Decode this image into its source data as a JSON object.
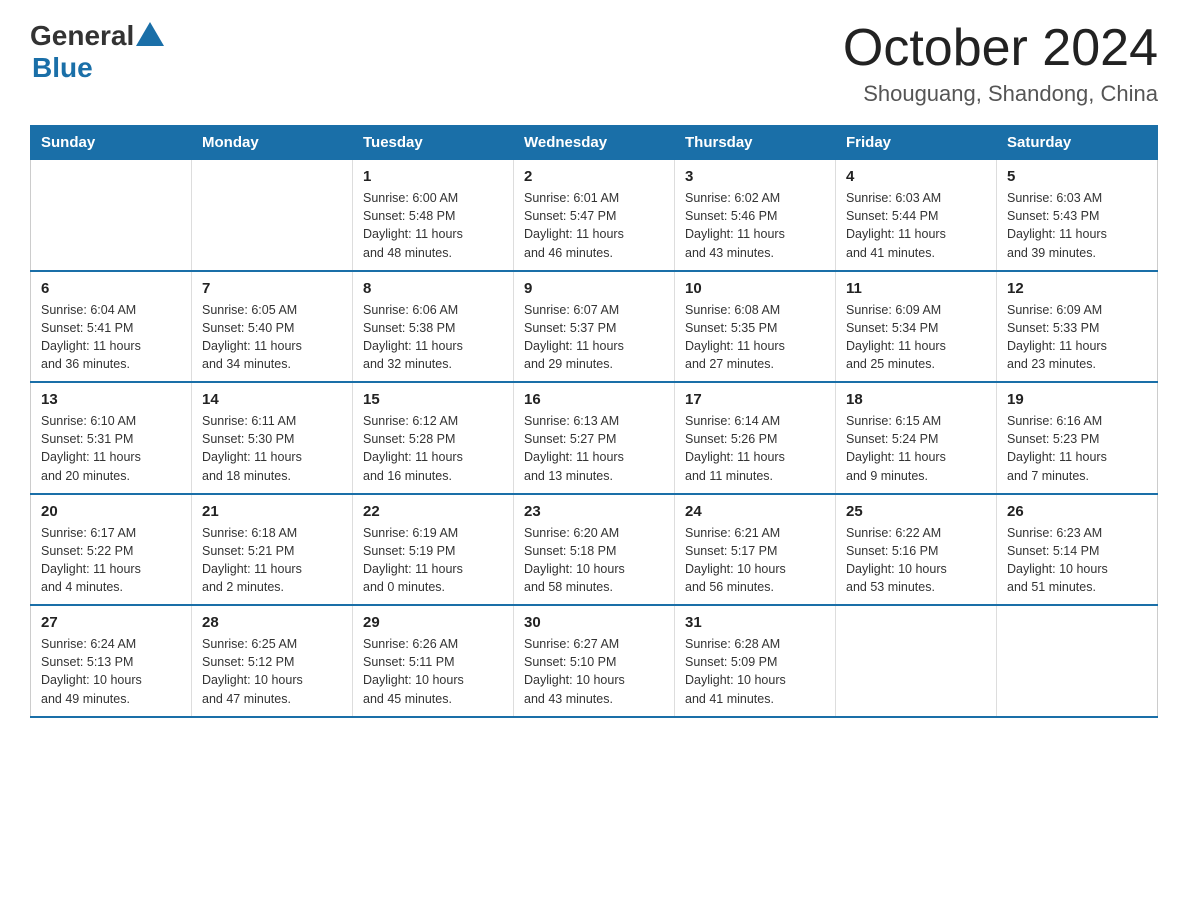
{
  "header": {
    "title": "October 2024",
    "subtitle": "Shouguang, Shandong, China",
    "logo_general": "General",
    "logo_blue": "Blue"
  },
  "weekdays": [
    "Sunday",
    "Monday",
    "Tuesday",
    "Wednesday",
    "Thursday",
    "Friday",
    "Saturday"
  ],
  "weeks": [
    [
      {
        "day": "",
        "info": ""
      },
      {
        "day": "",
        "info": ""
      },
      {
        "day": "1",
        "info": "Sunrise: 6:00 AM\nSunset: 5:48 PM\nDaylight: 11 hours\nand 48 minutes."
      },
      {
        "day": "2",
        "info": "Sunrise: 6:01 AM\nSunset: 5:47 PM\nDaylight: 11 hours\nand 46 minutes."
      },
      {
        "day": "3",
        "info": "Sunrise: 6:02 AM\nSunset: 5:46 PM\nDaylight: 11 hours\nand 43 minutes."
      },
      {
        "day": "4",
        "info": "Sunrise: 6:03 AM\nSunset: 5:44 PM\nDaylight: 11 hours\nand 41 minutes."
      },
      {
        "day": "5",
        "info": "Sunrise: 6:03 AM\nSunset: 5:43 PM\nDaylight: 11 hours\nand 39 minutes."
      }
    ],
    [
      {
        "day": "6",
        "info": "Sunrise: 6:04 AM\nSunset: 5:41 PM\nDaylight: 11 hours\nand 36 minutes."
      },
      {
        "day": "7",
        "info": "Sunrise: 6:05 AM\nSunset: 5:40 PM\nDaylight: 11 hours\nand 34 minutes."
      },
      {
        "day": "8",
        "info": "Sunrise: 6:06 AM\nSunset: 5:38 PM\nDaylight: 11 hours\nand 32 minutes."
      },
      {
        "day": "9",
        "info": "Sunrise: 6:07 AM\nSunset: 5:37 PM\nDaylight: 11 hours\nand 29 minutes."
      },
      {
        "day": "10",
        "info": "Sunrise: 6:08 AM\nSunset: 5:35 PM\nDaylight: 11 hours\nand 27 minutes."
      },
      {
        "day": "11",
        "info": "Sunrise: 6:09 AM\nSunset: 5:34 PM\nDaylight: 11 hours\nand 25 minutes."
      },
      {
        "day": "12",
        "info": "Sunrise: 6:09 AM\nSunset: 5:33 PM\nDaylight: 11 hours\nand 23 minutes."
      }
    ],
    [
      {
        "day": "13",
        "info": "Sunrise: 6:10 AM\nSunset: 5:31 PM\nDaylight: 11 hours\nand 20 minutes."
      },
      {
        "day": "14",
        "info": "Sunrise: 6:11 AM\nSunset: 5:30 PM\nDaylight: 11 hours\nand 18 minutes."
      },
      {
        "day": "15",
        "info": "Sunrise: 6:12 AM\nSunset: 5:28 PM\nDaylight: 11 hours\nand 16 minutes."
      },
      {
        "day": "16",
        "info": "Sunrise: 6:13 AM\nSunset: 5:27 PM\nDaylight: 11 hours\nand 13 minutes."
      },
      {
        "day": "17",
        "info": "Sunrise: 6:14 AM\nSunset: 5:26 PM\nDaylight: 11 hours\nand 11 minutes."
      },
      {
        "day": "18",
        "info": "Sunrise: 6:15 AM\nSunset: 5:24 PM\nDaylight: 11 hours\nand 9 minutes."
      },
      {
        "day": "19",
        "info": "Sunrise: 6:16 AM\nSunset: 5:23 PM\nDaylight: 11 hours\nand 7 minutes."
      }
    ],
    [
      {
        "day": "20",
        "info": "Sunrise: 6:17 AM\nSunset: 5:22 PM\nDaylight: 11 hours\nand 4 minutes."
      },
      {
        "day": "21",
        "info": "Sunrise: 6:18 AM\nSunset: 5:21 PM\nDaylight: 11 hours\nand 2 minutes."
      },
      {
        "day": "22",
        "info": "Sunrise: 6:19 AM\nSunset: 5:19 PM\nDaylight: 11 hours\nand 0 minutes."
      },
      {
        "day": "23",
        "info": "Sunrise: 6:20 AM\nSunset: 5:18 PM\nDaylight: 10 hours\nand 58 minutes."
      },
      {
        "day": "24",
        "info": "Sunrise: 6:21 AM\nSunset: 5:17 PM\nDaylight: 10 hours\nand 56 minutes."
      },
      {
        "day": "25",
        "info": "Sunrise: 6:22 AM\nSunset: 5:16 PM\nDaylight: 10 hours\nand 53 minutes."
      },
      {
        "day": "26",
        "info": "Sunrise: 6:23 AM\nSunset: 5:14 PM\nDaylight: 10 hours\nand 51 minutes."
      }
    ],
    [
      {
        "day": "27",
        "info": "Sunrise: 6:24 AM\nSunset: 5:13 PM\nDaylight: 10 hours\nand 49 minutes."
      },
      {
        "day": "28",
        "info": "Sunrise: 6:25 AM\nSunset: 5:12 PM\nDaylight: 10 hours\nand 47 minutes."
      },
      {
        "day": "29",
        "info": "Sunrise: 6:26 AM\nSunset: 5:11 PM\nDaylight: 10 hours\nand 45 minutes."
      },
      {
        "day": "30",
        "info": "Sunrise: 6:27 AM\nSunset: 5:10 PM\nDaylight: 10 hours\nand 43 minutes."
      },
      {
        "day": "31",
        "info": "Sunrise: 6:28 AM\nSunset: 5:09 PM\nDaylight: 10 hours\nand 41 minutes."
      },
      {
        "day": "",
        "info": ""
      },
      {
        "day": "",
        "info": ""
      }
    ]
  ]
}
